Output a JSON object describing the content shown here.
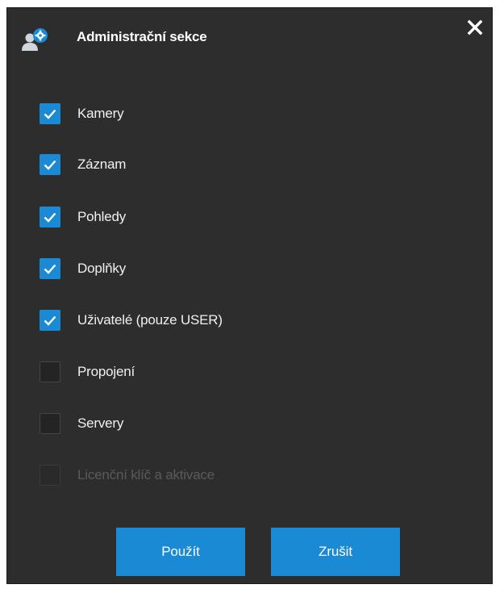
{
  "dialog": {
    "title": "Administrační sekce",
    "title_icon": "user-settings-icon",
    "close_icon": "close-icon"
  },
  "options": [
    {
      "label": "Kamery",
      "checked": true,
      "enabled": true
    },
    {
      "label": "Záznam",
      "checked": true,
      "enabled": true
    },
    {
      "label": "Pohledy",
      "checked": true,
      "enabled": true
    },
    {
      "label": "Doplňky",
      "checked": true,
      "enabled": true
    },
    {
      "label": "Uživatelé (pouze USER)",
      "checked": true,
      "enabled": true
    },
    {
      "label": "Propojení",
      "checked": false,
      "enabled": true
    },
    {
      "label": "Servery",
      "checked": false,
      "enabled": true
    },
    {
      "label": "Licenční klíč a aktivace",
      "checked": false,
      "enabled": false
    }
  ],
  "buttons": {
    "apply_label": "Použít",
    "cancel_label": "Zrušit"
  },
  "colors": {
    "background": "#2d2d2d",
    "accent": "#1a8ad4",
    "text": "#f0f0f0",
    "disabled_text": "#5a5a5a"
  }
}
